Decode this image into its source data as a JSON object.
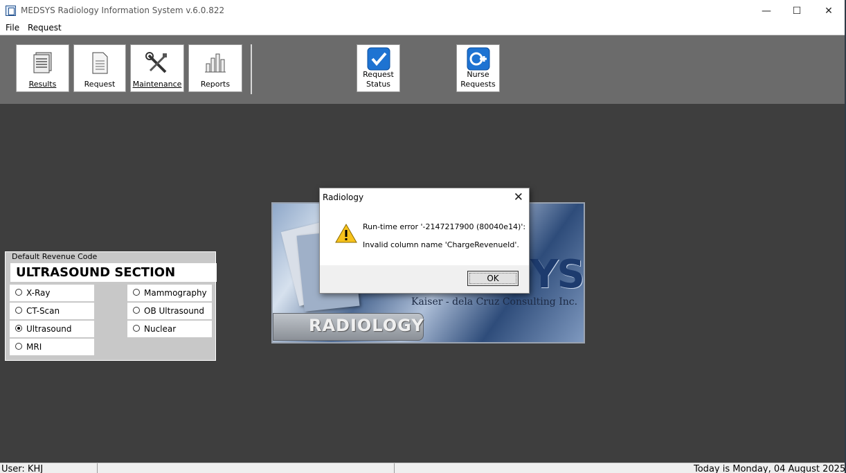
{
  "window": {
    "title": "MEDSYS Radiology Information System  v.6.0.822",
    "minimize_glyph": "—",
    "maximize_glyph": "☐",
    "close_glyph": "✕"
  },
  "menu": [
    "File",
    "Request"
  ],
  "toolbar": {
    "results": "Results",
    "request": "Request",
    "maintenance": "Maintenance",
    "reports": "Reports",
    "request_status_line1": "Request",
    "request_status_line2": "Status",
    "nurse_line1": "Nurse",
    "nurse_line2": "Requests"
  },
  "revenue_panel": {
    "legend": "Default Revenue Code",
    "section": "ULTRASOUND SECTION",
    "options": {
      "xray": "X-Ray",
      "ctscan": "CT-Scan",
      "ultrasound": "Ultrasound",
      "mri": "MRI",
      "mammography": "Mammography",
      "ob_ultrasound": "OB Ultrasound",
      "nuclear": "Nuclear"
    },
    "selected": "Ultrasound"
  },
  "splash": {
    "big_text": "YS",
    "company": "Kaiser - dela Cruz Consulting Inc.",
    "label": "RADIOLOGY"
  },
  "dialog": {
    "title": "Radiology",
    "close_glyph": "✕",
    "line1": "Run-time error '-2147217900 (80040e14)':",
    "line2": "Invalid column name 'ChargeRevenueId'.",
    "ok": "OK"
  },
  "status": {
    "user": "User: KHJ",
    "date": "Today is Monday, 04 August 2025"
  },
  "colors": {
    "workspace": "#3e3e3e",
    "toolbar": "#6b6b6b",
    "check_blue": "#1e73d2"
  }
}
